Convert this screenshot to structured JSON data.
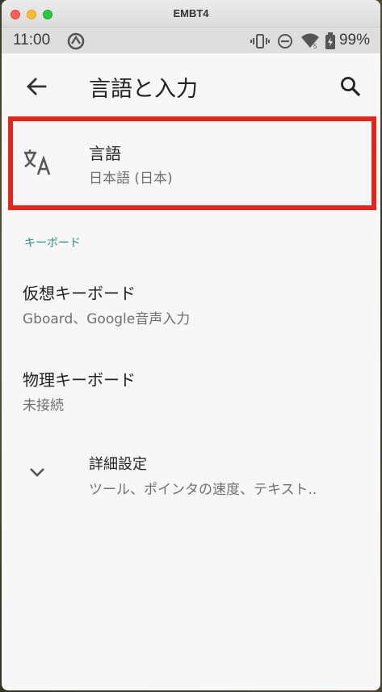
{
  "window": {
    "title": "EMBT4"
  },
  "status_bar": {
    "time": "11:00",
    "battery": "99%"
  },
  "app_bar": {
    "title": "言語と入力"
  },
  "language_item": {
    "title": "言語",
    "subtitle": "日本語 (日本)"
  },
  "keyboard_section": {
    "header": "キーボード",
    "items": [
      {
        "title": "仮想キーボード",
        "subtitle": "Gboard、Google音声入力"
      },
      {
        "title": "物理キーボード",
        "subtitle": "未接続"
      }
    ]
  },
  "advanced": {
    "title": "詳細設定",
    "subtitle": "ツール、ポインタの速度、テキスト.."
  },
  "colors": {
    "accent": "#2f8c84",
    "highlight": "#e0271b"
  }
}
